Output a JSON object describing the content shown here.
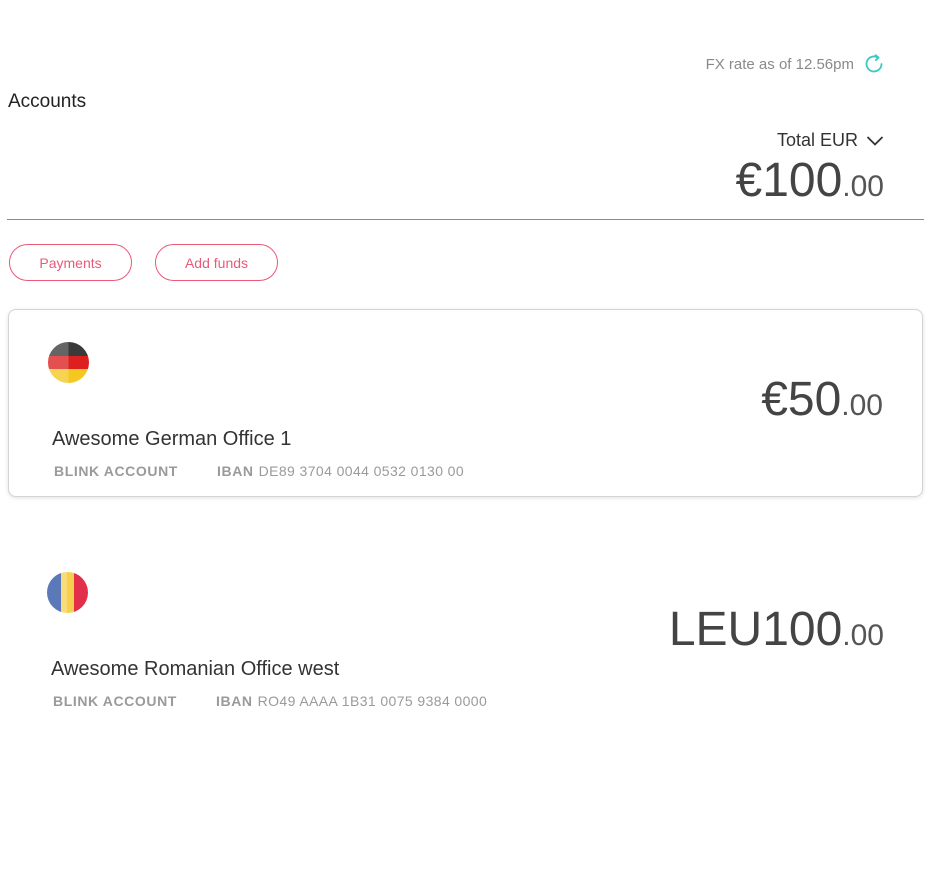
{
  "header": {
    "fx_rate_text": "FX rate as of 12.56pm",
    "refresh_icon": "refresh-icon",
    "title": "Accounts"
  },
  "total": {
    "label": "Total EUR",
    "amount_major": "€100",
    "amount_decimal": ".00"
  },
  "actions": {
    "payments_label": "Payments",
    "add_funds_label": "Add funds"
  },
  "accounts": [
    {
      "flag": "germany-flag-icon",
      "name": "Awesome German Office 1",
      "type": "BLINK ACCOUNT",
      "iban_label": "IBAN",
      "iban": "DE89 3704 0044 0532 0130 00",
      "amount_major": "€50",
      "amount_decimal": ".00",
      "selected": true
    },
    {
      "flag": "romania-flag-icon",
      "name": "Awesome Romanian Office west",
      "type": "BLINK ACCOUNT",
      "iban_label": "IBAN",
      "iban": "RO49 AAAA 1B31 0075 9384 0000",
      "amount_major": "LEU100",
      "amount_decimal": ".00",
      "selected": false
    }
  ],
  "colors": {
    "accent": "#e85a78",
    "refresh": "#3cc7c1",
    "divider": "#8a8a8a"
  }
}
